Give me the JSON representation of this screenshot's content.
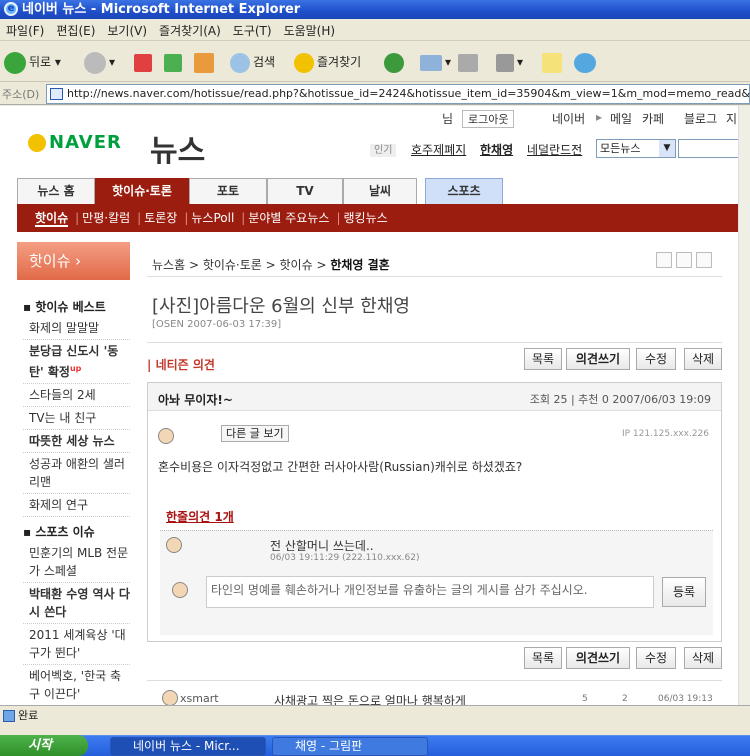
{
  "window": {
    "title": "네이버 뉴스 - Microsoft Internet Explorer"
  },
  "menu": [
    "파일(F)",
    "편집(E)",
    "보기(V)",
    "즐겨찾기(A)",
    "도구(T)",
    "도움말(H)"
  ],
  "toolbar": {
    "back": "뒤로",
    "search": "검색",
    "favorites": "즐겨찾기"
  },
  "address": {
    "label": "주소(D)",
    "url": "http://news.naver.com/hotissue/read.php?&hotissue_id=2424&hotissue_item_id=35904&m_view=1&m_mod=memo_read&"
  },
  "naver": {
    "util": {
      "nim": "님",
      "logout": "로그아웃",
      "links": [
        "네이버",
        "메일",
        "카페",
        "블로그",
        "지"
      ]
    },
    "logo": "NAVER",
    "logo2": "뉴스",
    "popular": {
      "badge": "인기",
      "items": [
        "호주제폐지",
        "한채영",
        "네덜란드전"
      ]
    },
    "select": "모든뉴스",
    "tabs": [
      "뉴스 홈",
      "핫이슈·토론",
      "포토",
      "TV",
      "날씨",
      "스포츠"
    ],
    "subnav": [
      "핫이슈",
      "만평·칼럼",
      "토론장",
      "뉴스Poll",
      "분야별 주요뉴스",
      "랭킹뉴스"
    ],
    "left": {
      "banner": "핫이슈 ›",
      "best_title": "핫이슈 베스트",
      "best": [
        "화제의 말말말",
        "분당급 신도시 '동탄' 확정",
        "스타들의 2세",
        "TV는 내 친구",
        "따뜻한 세상 뉴스",
        "성공과 애환의 샐러리맨",
        "화제의 연구"
      ],
      "sports_title": "스포츠 이슈",
      "sports": [
        "민훈기의 MLB 전문가 스페셜",
        "박태환 수영 역사 다시 쓴다",
        "2011 세계육상 '대구가 뛴다'",
        "베어벡호, '한국 축구 이끈다'"
      ],
      "up": "up"
    },
    "breadcrumb": [
      "뉴스홈",
      "핫이슈·토론",
      "핫이슈",
      "한채영 결혼"
    ],
    "article": {
      "title": "[사진]아름다운 6월의 신부 한채영",
      "source": "[OSEN 2007-06-03 17:39]"
    },
    "netizen": "네티즌 의견",
    "buttons": [
      "목록",
      "의견쓰기",
      "수정",
      "삭제"
    ],
    "comment": {
      "title": "아놔 무이자!~",
      "meta": "조회 25 | 추천 0    2007/06/03 19:09",
      "other": "다른 글 보기",
      "ip": "IP 121.125.xxx.226",
      "body": "혼수비용은 이자걱정없고 간편한 러사아사람(Russian)캐쉬로 하셨겠죠?",
      "reply_head": "한줄의견 1개",
      "reply_text": "전 산할머니 쓰는데..",
      "reply_meta": "06/03 19:11:29  (222.110.xxx.62)",
      "input_placeholder": "타인의 명예를 훼손하거나 개인정보를 유출하는 글의 게시를 삼가 주십시오.",
      "register": "등록"
    },
    "next": {
      "user": "xsmart",
      "title": "사채광고 찍은 돈으로 얼마나 행복하게",
      "views": "5",
      "rec": "2",
      "date": "06/03 19:13"
    }
  },
  "status": "완료",
  "taskbar": {
    "start": "시작",
    "tasks": [
      "네이버 뉴스 - Micr...",
      "채영 - 그림판"
    ]
  }
}
